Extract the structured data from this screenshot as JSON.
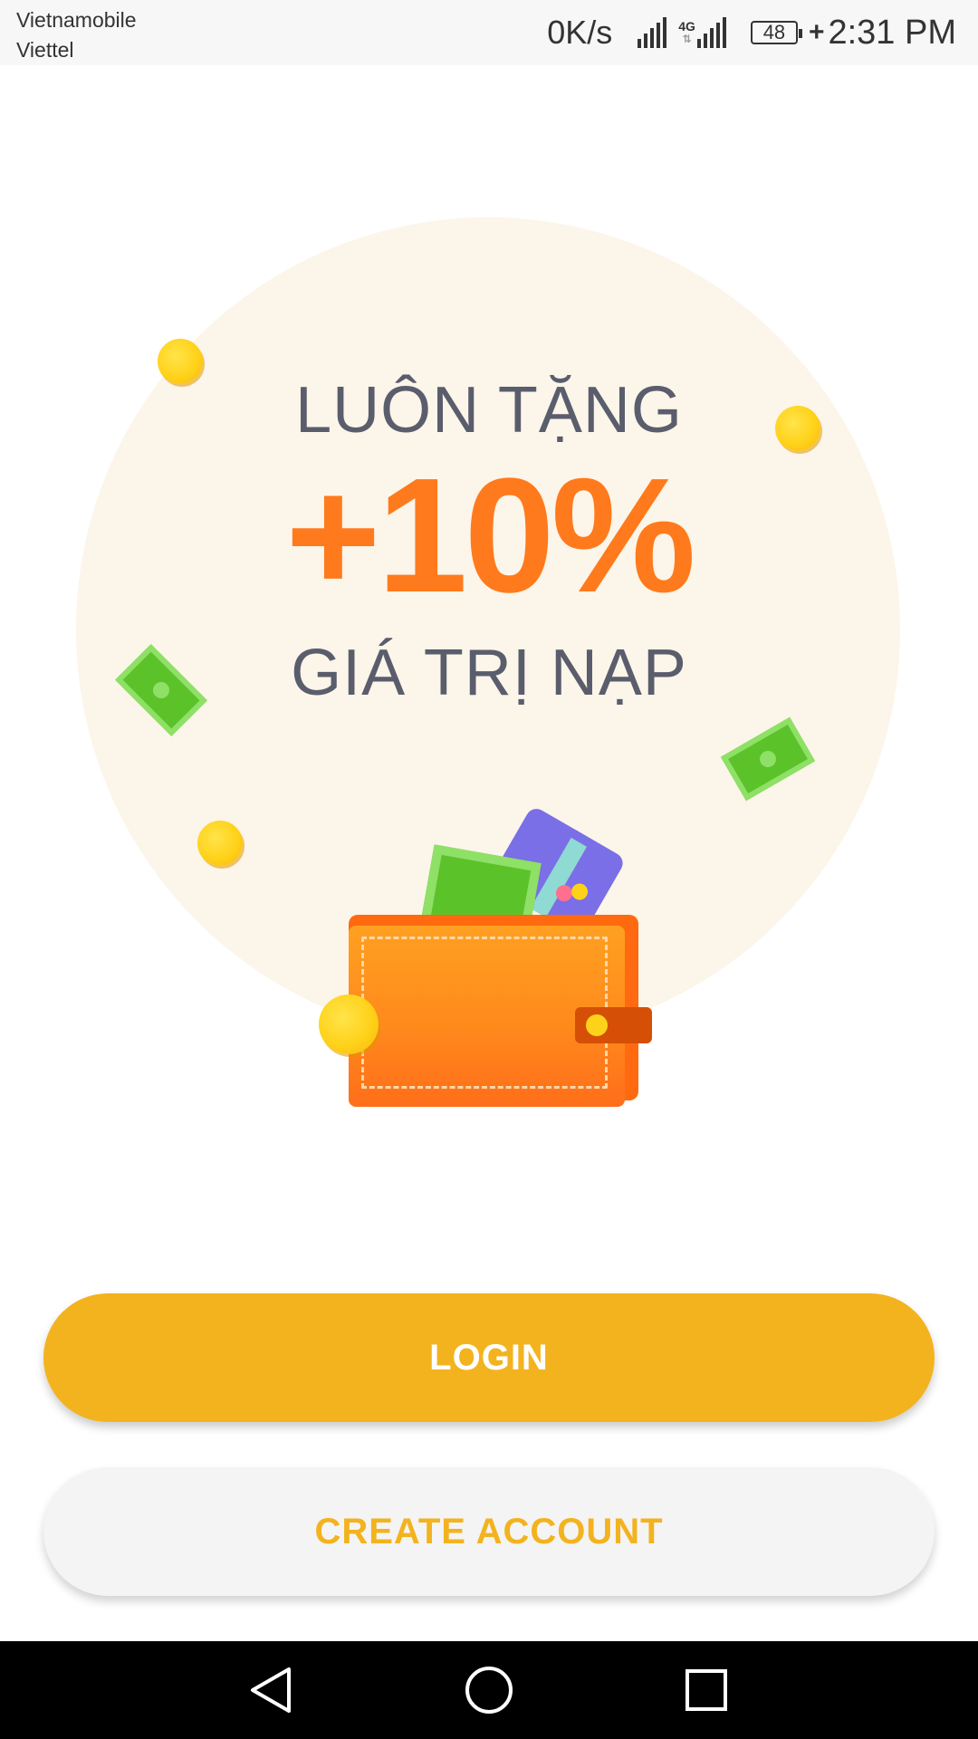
{
  "status_bar": {
    "carrier_1": "Vietnamobile",
    "carrier_2": "Viettel",
    "network_speed": "0K/s",
    "network_type": "4G",
    "battery_level": "48",
    "time": "2:31 PM",
    "icons": [
      "signal-icon",
      "signal-4g-icon",
      "battery-icon",
      "charging-icon"
    ]
  },
  "promo": {
    "line_1": "LUÔN TẶNG",
    "highlight": "+10%",
    "line_2": "GIÁ TRỊ NẠP",
    "accent_color": "#ff7a1c",
    "text_color": "#5a5d6c",
    "circle_color": "#fcf5e9",
    "illustration": "wallet-with-money-illustration"
  },
  "actions": {
    "login_label": "LOGIN",
    "create_account_label": "CREATE ACCOUNT",
    "primary_color": "#f3b31f",
    "secondary_bg": "#f4f4f4"
  },
  "nav_bar": {
    "icons": [
      "back-icon",
      "home-icon",
      "recents-icon"
    ]
  }
}
